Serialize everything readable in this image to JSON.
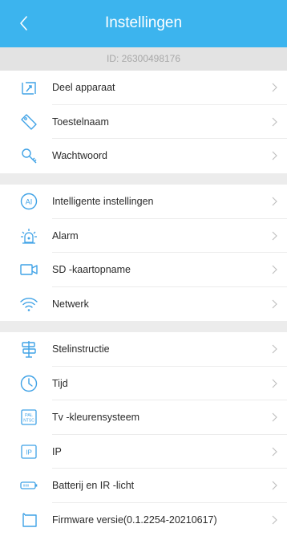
{
  "header": {
    "title": "Instellingen",
    "back_icon": "chevron-left-icon"
  },
  "id_bar": {
    "text": "ID: 26300498176"
  },
  "colors": {
    "accent": "#3cb4ee",
    "id_bar_bg": "#e3e3e3",
    "gap_bg": "#ececec",
    "icon": "#3fa2e6"
  },
  "sections": [
    {
      "items": [
        {
          "icon": "share-icon",
          "label": "Deel apparaat"
        },
        {
          "icon": "tag-icon",
          "label": "Toestelnaam"
        },
        {
          "icon": "key-icon",
          "label": "Wachtwoord"
        }
      ]
    },
    {
      "items": [
        {
          "icon": "ai-icon",
          "label": "Intelligente instellingen"
        },
        {
          "icon": "alarm-icon",
          "label": "Alarm"
        },
        {
          "icon": "camera-icon",
          "label": "SD -kaartopname"
        },
        {
          "icon": "wifi-icon",
          "label": "Netwerk"
        }
      ]
    },
    {
      "items": [
        {
          "icon": "signpost-icon",
          "label": "Stelinstructie"
        },
        {
          "icon": "clock-icon",
          "label": "Tijd"
        },
        {
          "icon": "pal-ntsc-icon",
          "label": "Tv -kleurensysteem"
        },
        {
          "icon": "ip-icon",
          "label": "IP"
        },
        {
          "icon": "battery-icon",
          "label": "Batterij en IR -licht"
        },
        {
          "icon": "firmware-icon",
          "label": "Firmware versie(0.1.2254-20210617)"
        }
      ]
    }
  ]
}
